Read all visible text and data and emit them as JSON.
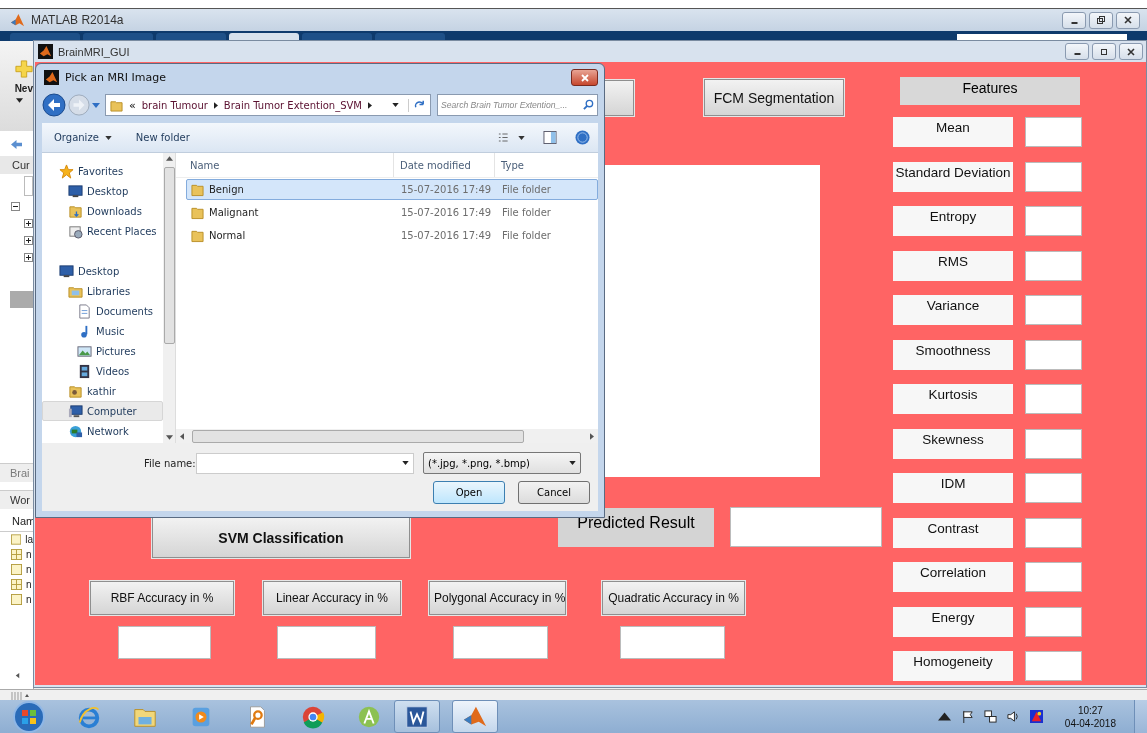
{
  "matlab_window": {
    "title": "MATLAB R2014a",
    "tabs": [
      {
        "selected": false
      },
      {
        "selected": false
      },
      {
        "selected": false
      },
      {
        "selected": true
      },
      {
        "selected": false
      },
      {
        "selected": false
      }
    ],
    "side_panel": {
      "toolbar_label": "Nev",
      "current_folder_label": "Cur",
      "details_label": "Brai",
      "workspace_label": "Wor",
      "name_header": "Nam",
      "variables": [
        "la",
        "n",
        "n",
        "n",
        "n"
      ]
    }
  },
  "gui_window": {
    "title": "BrainMRI_GUI",
    "fcm_button": "FCM Segmentation",
    "features_header": "Features",
    "features": [
      {
        "label": "Mean"
      },
      {
        "label": "Standard Deviation"
      },
      {
        "label": "Entropy"
      },
      {
        "label": "RMS"
      },
      {
        "label": "Variance"
      },
      {
        "label": "Smoothness"
      },
      {
        "label": "Kurtosis"
      },
      {
        "label": "Skewness"
      },
      {
        "label": "IDM"
      },
      {
        "label": "Contrast"
      },
      {
        "label": "Correlation"
      },
      {
        "label": "Energy"
      },
      {
        "label": "Homogeneity"
      }
    ],
    "predicted_label": "Predicted Result",
    "svm_button": "SVM Classification",
    "accuracy": [
      {
        "label": "RBF Accuracy in %"
      },
      {
        "label": "Linear Accuracy in %"
      },
      {
        "label": "Polygonal Accuracy in %"
      },
      {
        "label": "Quadratic Accuracy in %"
      }
    ]
  },
  "dialog": {
    "title": "Pick an MRI Image",
    "overflow_marker": "«",
    "breadcrumb": [
      "brain Tumour",
      "Brain Tumor Extention_SVM"
    ],
    "search": {
      "placeholder": "Search Brain Tumor Extention_..."
    },
    "toolbar": [
      "Organize",
      "New folder"
    ],
    "nav": [
      {
        "label": "Favorites",
        "selected": false,
        "children": [
          {
            "label": "Desktop",
            "selected": false
          },
          {
            "label": "Downloads",
            "selected": false
          },
          {
            "label": "Recent Places",
            "selected": false
          }
        ]
      },
      {
        "label": "Desktop",
        "selected": false,
        "children": [
          {
            "label": "Libraries",
            "selected": false,
            "children": [
              {
                "label": "Documents",
                "selected": false
              },
              {
                "label": "Music",
                "selected": false
              },
              {
                "label": "Pictures",
                "selected": false
              },
              {
                "label": "Videos",
                "selected": false
              }
            ]
          },
          {
            "label": "kathir",
            "selected": false
          },
          {
            "label": "Computer",
            "selected": true
          },
          {
            "label": "Network",
            "selected": false
          }
        ]
      }
    ],
    "columns": [
      "Name",
      "Date modified",
      "Type"
    ],
    "rows": [
      {
        "name": "Benign",
        "date": "15-07-2016 17:49",
        "type": "File folder",
        "selected": true
      },
      {
        "name": "Malignant",
        "date": "15-07-2016 17:49",
        "type": "File folder",
        "selected": false
      },
      {
        "name": "Normal",
        "date": "15-07-2016 17:49",
        "type": "File folder",
        "selected": false
      }
    ],
    "file_name_label": "File name:",
    "filter": "(*.jpg, *.png, *.bmp)",
    "buttons": [
      "Open",
      "Cancel"
    ]
  },
  "taskbar": {
    "time": "10:27",
    "date": "04-04-2018"
  }
}
